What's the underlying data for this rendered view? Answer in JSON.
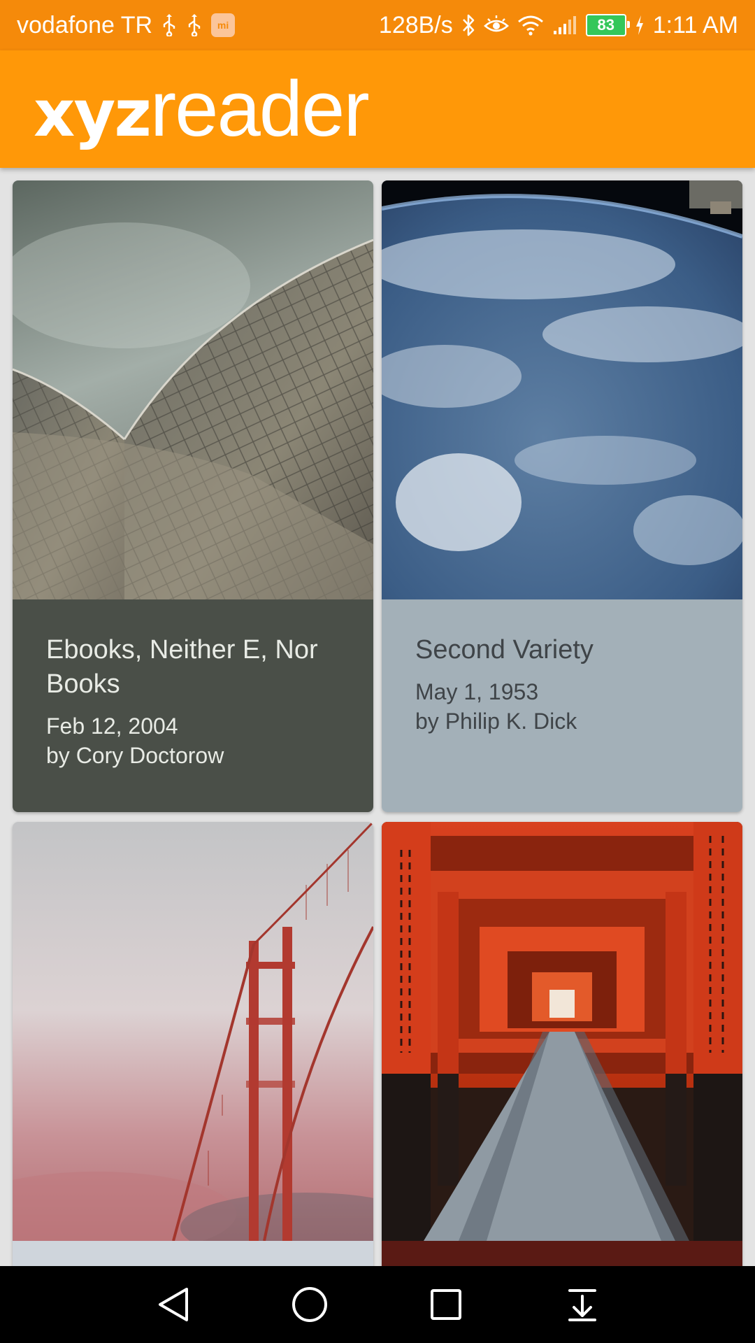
{
  "status_bar": {
    "carrier": "vodafone TR",
    "speed": "128B/s",
    "battery": "83",
    "time": "1:11 AM",
    "mi_badge": "mi"
  },
  "app_bar": {
    "logo_bold": "xyz",
    "logo_light": "reader"
  },
  "articles": [
    {
      "title": "Ebooks, Neither E, Nor Books",
      "date": "Feb 12, 2004",
      "author": "by Cory Doctorow",
      "color": "#4a4f48",
      "text_color": "#e8ebe5"
    },
    {
      "title": "Second Variety",
      "date": "May 1, 1953",
      "author": "by Philip K. Dick",
      "color": "#a3b0b8",
      "text_color": "#3f4448"
    },
    {
      "title": "",
      "date": "",
      "author": "",
      "color": "#cfd5dc",
      "text_color": "#3f4448"
    },
    {
      "title": "",
      "date": "",
      "author": "",
      "color": "#5a1a14",
      "text_color": "#f1dcd8"
    }
  ],
  "nav": {
    "back": "back-icon",
    "home": "home-icon",
    "recents": "recents-icon",
    "notifications": "pull-down-icon"
  }
}
